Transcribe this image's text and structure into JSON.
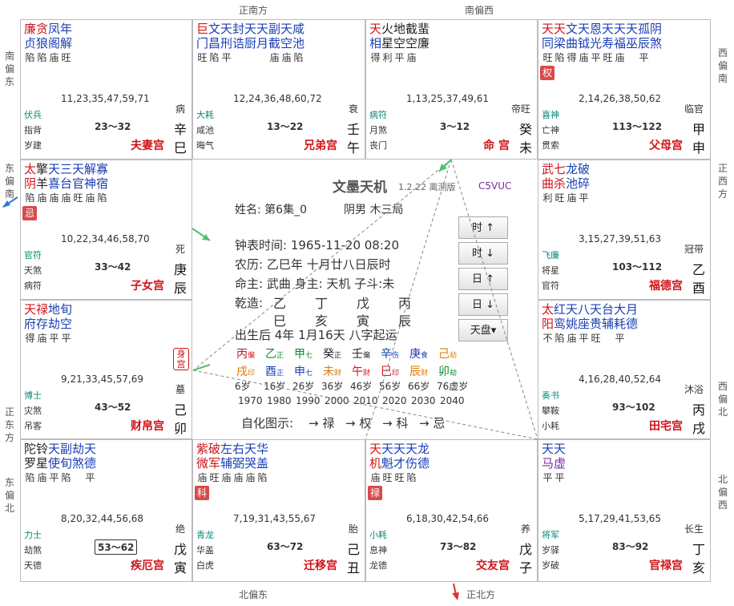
{
  "directions": {
    "top": [
      "正南方",
      "南偏西"
    ],
    "bottom": [
      "北偏东",
      "正北方"
    ],
    "left": [
      "南偏东",
      "东偏南",
      "正东方",
      "东偏北"
    ],
    "right": [
      "西偏南",
      "正西方",
      "西偏北",
      "北偏西"
    ]
  },
  "palaces": [
    {
      "stars": [
        [
          "廉",
          "red"
        ],
        [
          "贪",
          "red"
        ],
        [
          "凤",
          "blue"
        ],
        [
          "年",
          "blue"
        ]
      ],
      "stars2": [
        [
          "贞",
          "blue"
        ],
        [
          "狼",
          "blue"
        ],
        [
          "阁",
          "blue"
        ],
        [
          "解",
          "blue"
        ]
      ],
      "bright": [
        "陷",
        "陷",
        "庙",
        "旺"
      ],
      "hua": "",
      "ages": "11,23,35,47,59,71",
      "s12": "病",
      "g1": "伏兵",
      "g2": "指背",
      "g3": "岁建",
      "daxian": "23～32",
      "stem": "辛",
      "branch": "巳",
      "name": "夫妻宫",
      "boxed": false
    },
    {
      "stars": [
        [
          "巨",
          "red"
        ],
        [
          "文",
          "blue"
        ],
        [
          "天",
          "blue"
        ],
        [
          "封",
          "blue"
        ],
        [
          "天",
          "blue"
        ],
        [
          "天",
          "blue"
        ],
        [
          "副",
          "blue"
        ],
        [
          "天",
          "blue"
        ],
        [
          "咸",
          "blue"
        ]
      ],
      "stars2": [
        [
          "门",
          "blue"
        ],
        [
          "昌",
          "blue"
        ],
        [
          "刑",
          "blue"
        ],
        [
          "诰",
          "blue"
        ],
        [
          "厨",
          "blue"
        ],
        [
          "月",
          "blue"
        ],
        [
          "截",
          "blue"
        ],
        [
          "空",
          "blue"
        ],
        [
          "池",
          "blue"
        ]
      ],
      "bright": [
        "旺",
        "陷",
        "平",
        "",
        "",
        "",
        "庙",
        "庙",
        "陷"
      ],
      "hua": "",
      "ages": "12,24,36,48,60,72",
      "s12": "衰",
      "g1": "大耗",
      "g2": "咸池",
      "g3": "晦气",
      "daxian": "13～22",
      "stem": "壬",
      "branch": "午",
      "name": "兄弟宫",
      "boxed": false
    },
    {
      "stars": [
        [
          "天",
          "red"
        ],
        [
          "火",
          "dark"
        ],
        [
          "地",
          "dark"
        ],
        [
          "截",
          "dark"
        ],
        [
          "蜚",
          "dark"
        ]
      ],
      "stars2": [
        [
          "相",
          "blue"
        ],
        [
          "星",
          "dark"
        ],
        [
          "空",
          "dark"
        ],
        [
          "空",
          "dark"
        ],
        [
          "廉",
          "dark"
        ]
      ],
      "bright": [
        "得",
        "利",
        "平",
        "庙"
      ],
      "hua": "",
      "ages": "1,13,25,37,49,61",
      "s12": "帝旺",
      "g1": "病符",
      "g2": "月煞",
      "g3": "丧门",
      "daxian": "3～12",
      "stem": "癸",
      "branch": "未",
      "name": "命 宫",
      "boxed": false
    },
    {
      "stars": [
        [
          "天",
          "red"
        ],
        [
          "天",
          "red"
        ],
        [
          "文",
          "blue"
        ],
        [
          "天",
          "blue"
        ],
        [
          "恩",
          "blue"
        ],
        [
          "天",
          "blue"
        ],
        [
          "天",
          "blue"
        ],
        [
          "天",
          "blue"
        ],
        [
          "孤",
          "blue"
        ],
        [
          "阴",
          "blue"
        ]
      ],
      "stars2": [
        [
          "同",
          "blue"
        ],
        [
          "梁",
          "blue"
        ],
        [
          "曲",
          "blue"
        ],
        [
          "钺",
          "blue"
        ],
        [
          "光",
          "blue"
        ],
        [
          "寿",
          "blue"
        ],
        [
          "福",
          "blue"
        ],
        [
          "巫",
          "blue"
        ],
        [
          "辰",
          "blue"
        ],
        [
          "煞",
          "blue"
        ]
      ],
      "bright": [
        "旺",
        "陷",
        "得",
        "庙",
        "平",
        "旺",
        "庙",
        "",
        "平"
      ],
      "hua": "权",
      "ages": "2,14,26,38,50,62",
      "s12": "临官",
      "g1": "喜神",
      "g2": "亡神",
      "g3": "贯索",
      "daxian": "113～122",
      "stem": "甲",
      "branch": "申",
      "name": "父母宫",
      "boxed": false
    },
    {
      "stars": [
        [
          "太",
          "red"
        ],
        [
          "擎",
          "dark"
        ],
        [
          "天",
          "blue"
        ],
        [
          "三",
          "blue"
        ],
        [
          "天",
          "blue"
        ],
        [
          "解",
          "blue"
        ],
        [
          "寡",
          "blue"
        ]
      ],
      "stars2": [
        [
          "阴",
          "red"
        ],
        [
          "羊",
          "dark"
        ],
        [
          "喜",
          "blue"
        ],
        [
          "台",
          "blue"
        ],
        [
          "官",
          "blue"
        ],
        [
          "神",
          "blue"
        ],
        [
          "宿",
          "blue"
        ]
      ],
      "bright": [
        "陷",
        "庙",
        "庙",
        "庙",
        "旺",
        "庙",
        "陷"
      ],
      "hua": "忌",
      "ages": "10,22,34,46,58,70",
      "s12": "死",
      "g1": "官符",
      "g2": "天煞",
      "g3": "病符",
      "daxian": "33～42",
      "stem": "庚",
      "branch": "辰",
      "name": "子女宫",
      "boxed": false
    },
    {
      "stars": [
        [
          "武",
          "red"
        ],
        [
          "七",
          "red"
        ],
        [
          "龙",
          "blue"
        ],
        [
          "破",
          "blue"
        ]
      ],
      "stars2": [
        [
          "曲",
          "red"
        ],
        [
          "杀",
          "red"
        ],
        [
          "池",
          "blue"
        ],
        [
          "碎",
          "blue"
        ]
      ],
      "bright": [
        "利",
        "旺",
        "庙",
        "平"
      ],
      "hua": "",
      "ages": "3,15,27,39,51,63",
      "s12": "冠带",
      "g1": "飞廉",
      "g2": "将星",
      "g3": "官符",
      "daxian": "103～112",
      "stem": "乙",
      "branch": "酉",
      "name": "福德宫",
      "boxed": false
    },
    {
      "stars": [
        [
          "天",
          "red"
        ],
        [
          "禄",
          "red"
        ],
        [
          "地",
          "blue"
        ],
        [
          "旬",
          "blue"
        ]
      ],
      "stars2": [
        [
          "府",
          "blue"
        ],
        [
          "存",
          "blue"
        ],
        [
          "劫",
          "blue"
        ],
        [
          "空",
          "blue"
        ]
      ],
      "bright": [
        "得",
        "庙",
        "平",
        "平"
      ],
      "hua": "",
      "ages": "9,21,33,45,57,69",
      "s12": "墓",
      "g1": "博士",
      "g2": "灾煞",
      "g3": "吊客",
      "daxian": "43～52",
      "stem": "己",
      "branch": "卯",
      "name": "财帛宫",
      "boxed": false
    },
    {
      "stars": [
        [
          "太",
          "red"
        ],
        [
          "红",
          "blue"
        ],
        [
          "天",
          "blue"
        ],
        [
          "八",
          "blue"
        ],
        [
          "天",
          "blue"
        ],
        [
          "台",
          "blue"
        ],
        [
          "大",
          "blue"
        ],
        [
          "月",
          "blue"
        ]
      ],
      "stars2": [
        [
          "阳",
          "red"
        ],
        [
          "鸾",
          "blue"
        ],
        [
          "姚",
          "blue"
        ],
        [
          "座",
          "blue"
        ],
        [
          "贵",
          "blue"
        ],
        [
          "辅",
          "blue"
        ],
        [
          "耗",
          "blue"
        ],
        [
          "德",
          "blue"
        ]
      ],
      "bright": [
        "不",
        "陷",
        "庙",
        "平",
        "旺",
        "",
        "平"
      ],
      "hua": "",
      "ages": "4,16,28,40,52,64",
      "s12": "沐浴",
      "g1": "奏书",
      "g2": "攀鞍",
      "g3": "小耗",
      "daxian": "93～102",
      "stem": "丙",
      "branch": "戌",
      "name": "田宅宫",
      "boxed": false
    },
    {
      "stars": [
        [
          "陀",
          "dark"
        ],
        [
          "铃",
          "dark"
        ],
        [
          "天",
          "blue"
        ],
        [
          "副",
          "blue"
        ],
        [
          "劫",
          "blue"
        ],
        [
          "天",
          "blue"
        ]
      ],
      "stars2": [
        [
          "罗",
          "dark"
        ],
        [
          "星",
          "dark"
        ],
        [
          "使",
          "blue"
        ],
        [
          "旬",
          "blue"
        ],
        [
          "煞",
          "blue"
        ],
        [
          "德",
          "blue"
        ]
      ],
      "bright": [
        "陷",
        "庙",
        "平",
        "陷",
        "",
        "平"
      ],
      "hua": "",
      "ages": "8,20,32,44,56,68",
      "s12": "绝",
      "g1": "力士",
      "g2": "劫煞",
      "g3": "天德",
      "daxian": "53～62",
      "stem": "戊",
      "branch": "寅",
      "name": "疾厄宫",
      "boxed": true
    },
    {
      "stars": [
        [
          "紫",
          "red"
        ],
        [
          "破",
          "red"
        ],
        [
          "左",
          "blue"
        ],
        [
          "右",
          "blue"
        ],
        [
          "天",
          "blue"
        ],
        [
          "华",
          "blue"
        ]
      ],
      "stars2": [
        [
          "微",
          "red"
        ],
        [
          "军",
          "red"
        ],
        [
          "辅",
          "blue"
        ],
        [
          "弼",
          "blue"
        ],
        [
          "哭",
          "blue"
        ],
        [
          "盖",
          "blue"
        ]
      ],
      "bright": [
        "庙",
        "旺",
        "庙",
        "庙",
        "庙",
        "陷"
      ],
      "hua": "科",
      "ages": "7,19,31,43,55,67",
      "s12": "胎",
      "g1": "青龙",
      "g2": "华盖",
      "g3": "白虎",
      "daxian": "63～72",
      "stem": "己",
      "branch": "丑",
      "name": "迁移宫",
      "boxed": false
    },
    {
      "stars": [
        [
          "天",
          "red"
        ],
        [
          "天",
          "blue"
        ],
        [
          "天",
          "blue"
        ],
        [
          "天",
          "blue"
        ],
        [
          "龙",
          "blue"
        ]
      ],
      "stars2": [
        [
          "机",
          "red"
        ],
        [
          "魁",
          "blue"
        ],
        [
          "才",
          "blue"
        ],
        [
          "伤",
          "blue"
        ],
        [
          "德",
          "blue"
        ]
      ],
      "bright": [
        "庙",
        "旺",
        "旺",
        "陷"
      ],
      "hua": "禄",
      "ages": "6,18,30,42,54,66",
      "s12": "养",
      "g1": "小耗",
      "g2": "息神",
      "g3": "龙德",
      "daxian": "73～82",
      "stem": "戊",
      "branch": "子",
      "name": "交友宫",
      "boxed": false
    },
    {
      "stars": [
        [
          "天",
          "blue"
        ],
        [
          "天",
          "blue"
        ]
      ],
      "stars2": [
        [
          "马",
          "purple"
        ],
        [
          "虚",
          "purple"
        ]
      ],
      "bright": [
        "平",
        "平"
      ],
      "hua": "",
      "ages": "5,17,29,41,53,65",
      "s12": "长生",
      "g1": "将军",
      "g2": "岁驿",
      "g3": "岁破",
      "daxian": "83～92",
      "stem": "丁",
      "branch": "亥",
      "name": "官禄宫",
      "boxed": false
    }
  ],
  "center": {
    "app_title": "文墨天机",
    "version": "1.2.22 离测版",
    "code": "C5VUC",
    "name_line": "姓名: 第6集_0",
    "gender": "阴男 木三局",
    "clock": "钟表时间: 1965-11-20 08:20",
    "lunar": "农历: 乙巳年 十月廿八日辰时",
    "master": "命主: 武曲 身主: 天机 子斗:未",
    "bazi_label": "乾造:",
    "bazi_stems": [
      [
        "乙",
        "green"
      ],
      [
        "丁",
        "red"
      ],
      [
        "戊",
        "orange"
      ],
      [
        "丙",
        "red"
      ]
    ],
    "bazi_branches": [
      [
        "巳",
        "red"
      ],
      [
        "亥",
        "dark"
      ],
      [
        "寅",
        "green"
      ],
      [
        "辰",
        "orange"
      ]
    ],
    "start_age": "出生后 4年 1月16天 八字起运",
    "dayun_stems": [
      [
        "丙",
        "red",
        "偏"
      ],
      [
        "乙",
        "green",
        "正"
      ],
      [
        "甲",
        "green",
        "七"
      ],
      [
        "癸",
        "dark",
        "正"
      ],
      [
        "壬",
        "dark",
        "偏"
      ],
      [
        "辛",
        "blue",
        "伤"
      ],
      [
        "庚",
        "blue",
        "食"
      ],
      [
        "己",
        "orange",
        "劫"
      ]
    ],
    "dayun_branches": [
      [
        "戌",
        "orange",
        "印"
      ],
      [
        "酉",
        "blue",
        "正"
      ],
      [
        "申",
        "blue",
        "七"
      ],
      [
        "未",
        "orange",
        "财"
      ],
      [
        "午",
        "red",
        "财"
      ],
      [
        "巳",
        "red",
        "印"
      ],
      [
        "辰",
        "orange",
        "财"
      ],
      [
        "卯",
        "green",
        "劫"
      ]
    ],
    "dayun_ages": [
      "6岁",
      "16岁",
      "26岁",
      "36岁",
      "46岁",
      "56岁",
      "66岁",
      "76虚岁"
    ],
    "dayun_years": [
      "1970",
      "1980",
      "1990",
      "2000",
      "2010",
      "2020",
      "2030",
      "2040"
    ],
    "self_label": "自化图示:",
    "self_items": [
      [
        "→ 禄",
        "green"
      ],
      [
        "→ 权",
        "purple"
      ],
      [
        "→ 科",
        "blue"
      ],
      [
        "→ 忌",
        "red"
      ]
    ]
  },
  "buttons": [
    "时 ↑",
    "时 ↓",
    "日 ↑",
    "日 ↓",
    "天盘▾"
  ],
  "body_palace": "身宫"
}
